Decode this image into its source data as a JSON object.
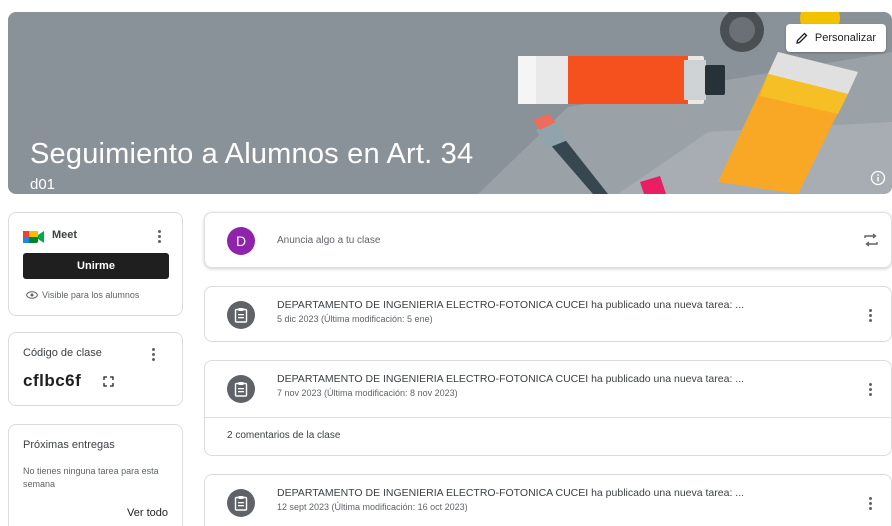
{
  "banner": {
    "title": "Seguimiento a Alumnos en Art. 34",
    "section": "d01",
    "customize_label": "Personalizar"
  },
  "meet": {
    "label": "Meet",
    "join_label": "Unirme",
    "visibility": "Visible para los alumnos"
  },
  "class_code": {
    "label": "Código de clase",
    "value": "cflbc6f"
  },
  "upcoming": {
    "title": "Próximas entregas",
    "empty_text": "No tienes ninguna tarea para esta semana",
    "view_all": "Ver todo"
  },
  "announce": {
    "avatar_letter": "D",
    "placeholder": "Anuncia algo a tu clase"
  },
  "posts": [
    {
      "title": "DEPARTAMENTO DE INGENIERIA ELECTRO-FOTONICA CUCEI ha publicado una nueva tarea: ...",
      "date": "5 dic 2023 (Última modificación: 5 ene)"
    },
    {
      "title": "DEPARTAMENTO DE INGENIERIA ELECTRO-FOTONICA CUCEI ha publicado una nueva tarea: ...",
      "date": "7 nov 2023 (Última modificación: 8 nov 2023)",
      "comments": "2 comentarios de la clase"
    },
    {
      "title": "DEPARTAMENTO DE INGENIERIA ELECTRO-FOTONICA CUCEI ha publicado una nueva tarea: ...",
      "date": "12 sept 2023 (Última modificación: 16 oct 2023)"
    }
  ],
  "colors": {
    "banner_bg": "#8a9299",
    "avatar": "#8e24aa",
    "join_button": "#1f1f1f"
  }
}
